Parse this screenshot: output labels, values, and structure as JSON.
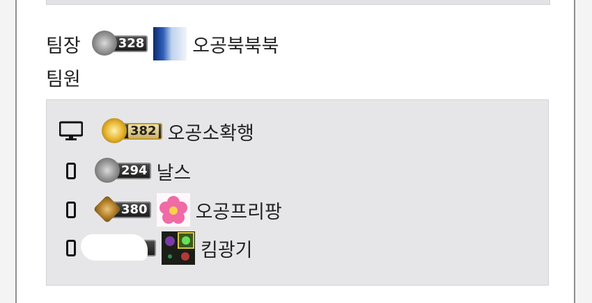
{
  "leader": {
    "label": "팀장",
    "level": "328",
    "nickname": "오공북북북"
  },
  "members_label": "팀원",
  "members": [
    {
      "device": "desktop-icon",
      "level": "382",
      "nickname": "오공소확행",
      "badge": "gold"
    },
    {
      "device": "mobile-icon",
      "level": "294",
      "nickname": "날스",
      "badge": "silver"
    },
    {
      "device": "mobile-icon",
      "level": "380",
      "nickname": "오공프리팡",
      "badge": "brown"
    },
    {
      "device": "mobile-icon",
      "level": "",
      "nickname": "킴광기",
      "badge": "brown"
    }
  ],
  "colors": {
    "panel_bg": "#e6e6e9",
    "text": "#222222",
    "card_border": "#8e8e8e"
  }
}
